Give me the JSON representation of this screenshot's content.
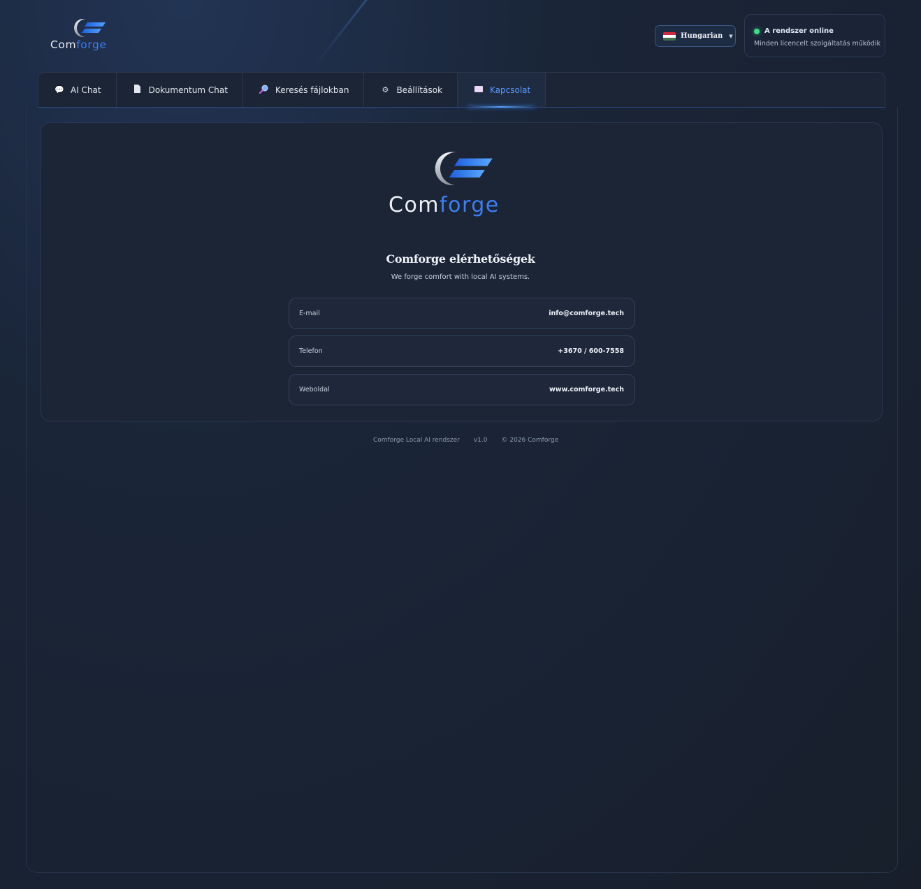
{
  "brand": {
    "name_part1": "Com",
    "name_part2": "forge"
  },
  "header": {
    "language": {
      "label": "Hungarian",
      "flag_colors": [
        "#cd2a3e",
        "#ffffff",
        "#436f4d"
      ]
    },
    "status": {
      "title": "A rendszer online",
      "subtitle": "Minden licencelt szolgáltatás működik",
      "indicator_color": "#3ddc84"
    }
  },
  "tabs": [
    {
      "icon": "speech-bubble-icon",
      "glyph": "💬",
      "label": "AI Chat",
      "active": false
    },
    {
      "icon": "document-icon",
      "glyph": "▮",
      "label": "Dokumentum Chat",
      "active": false
    },
    {
      "icon": "magnifier-icon",
      "glyph": "🔎",
      "label": "Keresés fájlokban",
      "active": false
    },
    {
      "icon": "gear-icon",
      "glyph": "⚙",
      "label": "Beállítások",
      "active": false
    },
    {
      "icon": "envelope-icon",
      "glyph": "▬",
      "label": "Kapcsolat",
      "active": true
    }
  ],
  "contact": {
    "heading": "Comforge elérhetőségek",
    "tagline": "We forge comfort with local AI systems.",
    "rows": [
      {
        "label": "E-mail",
        "value": "info@comforge.tech"
      },
      {
        "label": "Telefon",
        "value": "+3670 / 600-7558"
      },
      {
        "label": "Weboldal",
        "value": "www.comforge.tech"
      }
    ]
  },
  "footer": {
    "product": "Comforge Local AI rendszer",
    "version": "v1.0",
    "copyright": "© 2026 Comforge"
  },
  "colors": {
    "accent": "#3b7ff5",
    "active_tab": "#5b9bff",
    "background": "#1a2538"
  }
}
